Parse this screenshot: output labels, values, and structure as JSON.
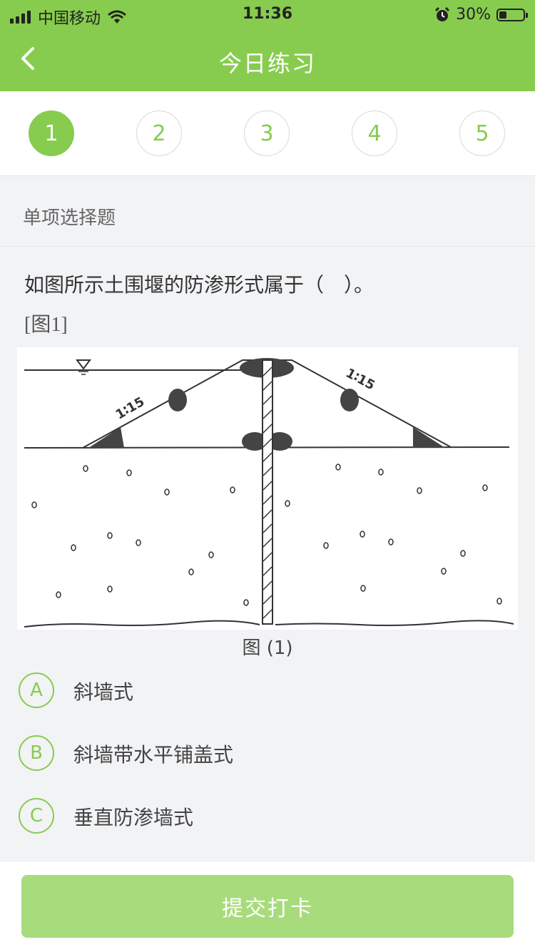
{
  "status_bar": {
    "carrier": "中国移动",
    "time": "11:36",
    "battery_percent": "30%",
    "battery_level": 0.3
  },
  "nav": {
    "title": "今日练习",
    "back_icon": "chevron-left-icon"
  },
  "steps": [
    {
      "label": "1",
      "active": true
    },
    {
      "label": "2",
      "active": false
    },
    {
      "label": "3",
      "active": false
    },
    {
      "label": "4",
      "active": false
    },
    {
      "label": "5",
      "active": false
    }
  ],
  "question": {
    "type": "单项选择题",
    "stem": "如图所示土围堰的防渗形式属于（　）。",
    "figure_ref": "[图1]",
    "figure_caption": "图 (1)",
    "figure_slope_left": "1∶15",
    "figure_slope_right": "1∶15",
    "options": [
      {
        "letter": "A",
        "text": "斜墙式"
      },
      {
        "letter": "B",
        "text": "斜墙带水平铺盖式"
      },
      {
        "letter": "C",
        "text": "垂直防渗墙式"
      }
    ]
  },
  "footer": {
    "submit_label": "提交打卡"
  },
  "colors": {
    "accent": "#87cc4e",
    "submit_disabled": "#a8db7c"
  }
}
